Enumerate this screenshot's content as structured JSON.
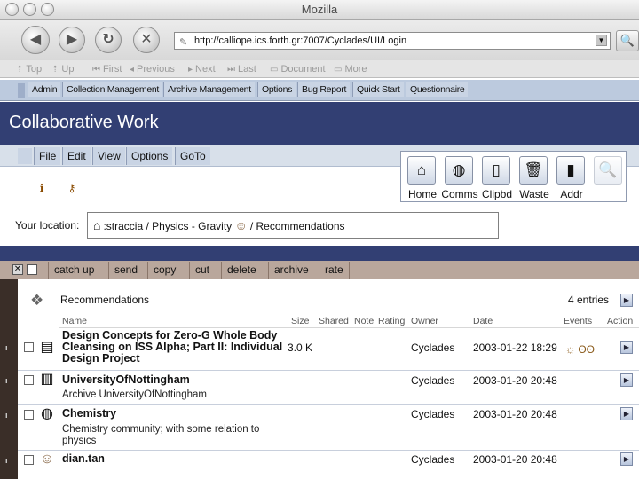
{
  "browser": {
    "window_title": "Mozilla",
    "url": "http://calliope.ics.forth.gr:7007/Cyclades/UI/Login",
    "site_nav": [
      "Top",
      "Up",
      "First",
      "Previous",
      "Next",
      "Last",
      "Document",
      "More"
    ]
  },
  "app_menu": [
    "Admin",
    "Collection Management",
    "Archive Management",
    "Options",
    "Bug Report",
    "Quick Start",
    "Questionnaire"
  ],
  "header": {
    "title": "Collaborative Work"
  },
  "menu": [
    "File",
    "Edit",
    "View",
    "Options",
    "GoTo"
  ],
  "toolbox": [
    {
      "label": "Home",
      "icon": "home-icon"
    },
    {
      "label": "Comms",
      "icon": "globe-icon"
    },
    {
      "label": "Clipbd",
      "icon": "clipboard-icon"
    },
    {
      "label": "Waste",
      "icon": "trash-icon"
    },
    {
      "label": "Addr",
      "icon": "address-book-icon"
    }
  ],
  "location": {
    "label": "Your location:",
    "path_part1": ":straccia / Physics - Gravity",
    "path_part2": "/ Recommendations"
  },
  "actions": [
    "catch up",
    "send",
    "copy",
    "cut",
    "delete",
    "archive",
    "rate"
  ],
  "listing": {
    "title": "Recommendations",
    "entries": "4 entries",
    "columns": {
      "name": "Name",
      "size": "Size",
      "shared": "Shared",
      "note": "Note",
      "rating": "Rating",
      "owner": "Owner",
      "date": "Date",
      "events": "Events",
      "action": "Action"
    },
    "rows": [
      {
        "name": "Design Concepts for Zero-G Whole Body Cleansing on ISS Alpha; Part II: Individual Design Project",
        "description": "",
        "size": "3.0 K",
        "owner": "Cyclades",
        "date": "2003-01-22 18:29",
        "events": "☼ ʘʘ",
        "icon": "document-icon"
      },
      {
        "name": "UniversityOfNottingham",
        "description": "Archive UniversityOfNottingham",
        "size": "",
        "owner": "Cyclades",
        "date": "2003-01-20 20:48",
        "events": "",
        "icon": "archive-icon"
      },
      {
        "name": "Chemistry",
        "description": "Chemistry community; with some relation to physics",
        "size": "",
        "owner": "Cyclades",
        "date": "2003-01-20 20:48",
        "events": "",
        "icon": "globe-icon"
      },
      {
        "name": "dian.tan",
        "description": "",
        "size": "",
        "owner": "Cyclades",
        "date": "2003-01-20 20:48",
        "events": "",
        "icon": "person-icon"
      }
    ]
  }
}
